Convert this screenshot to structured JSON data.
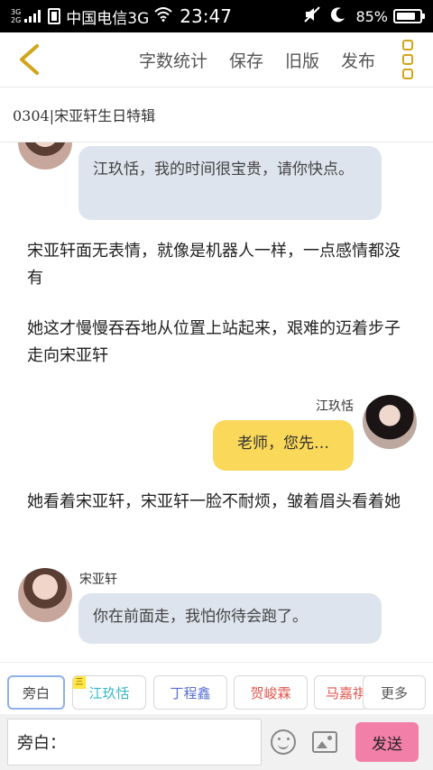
{
  "status_bar": {
    "network_top": "3G",
    "network_bottom": "2G",
    "carrier": "中国电信3G",
    "time": "23:47",
    "battery_percent": "85%",
    "battery_level": 0.85
  },
  "header": {
    "back_icon": "chevron-left-icon",
    "items": [
      "字数统计",
      "保存",
      "旧版",
      "发布"
    ],
    "menu_icon": "more-vertical-icon"
  },
  "title": "0304|宋亚轩生日特辑",
  "messages": [
    {
      "type": "bubble_left",
      "speaker": "",
      "text": "江玖恬，我的时间很宝贵，请你快点。"
    },
    {
      "type": "narration",
      "text": "宋亚轩面无表情，就像是机器人一样，一点感情都没有"
    },
    {
      "type": "narration",
      "text": "她这才慢慢吞吞地从位置上站起来，艰难的迈着步子走向宋亚轩"
    },
    {
      "type": "bubble_right",
      "speaker": "江玖恬",
      "text": "老师，您先…"
    },
    {
      "type": "narration",
      "text": "她看着宋亚轩，宋亚轩一脸不耐烦，皱着眉头看着她"
    },
    {
      "type": "bubble_left",
      "speaker": "宋亚轩",
      "text": "你在前面走，我怕你待会跑了。"
    }
  ],
  "characters": [
    {
      "label": "旁白",
      "color": "#444444",
      "selected": true,
      "badge": ""
    },
    {
      "label": "江玖恬",
      "color": "#35b8c4",
      "selected": false,
      "badge": "三"
    },
    {
      "label": "丁程鑫",
      "color": "#5a6fd0",
      "selected": false,
      "badge": ""
    },
    {
      "label": "贺峻霖",
      "color": "#e0554d",
      "selected": false,
      "badge": ""
    },
    {
      "label": "马嘉祺",
      "color": "#e0554d",
      "selected": false,
      "badge": ""
    }
  ],
  "more_label": "更多",
  "input": {
    "value": "旁白："
  },
  "send_label": "发送",
  "icons": {
    "emoji": "smiley-icon",
    "image": "image-icon"
  },
  "colors": {
    "bubble_left": "#dde4ed",
    "bubble_right": "#f9d85a",
    "send_button": "#f27fa8",
    "accent": "#d2a41a"
  }
}
